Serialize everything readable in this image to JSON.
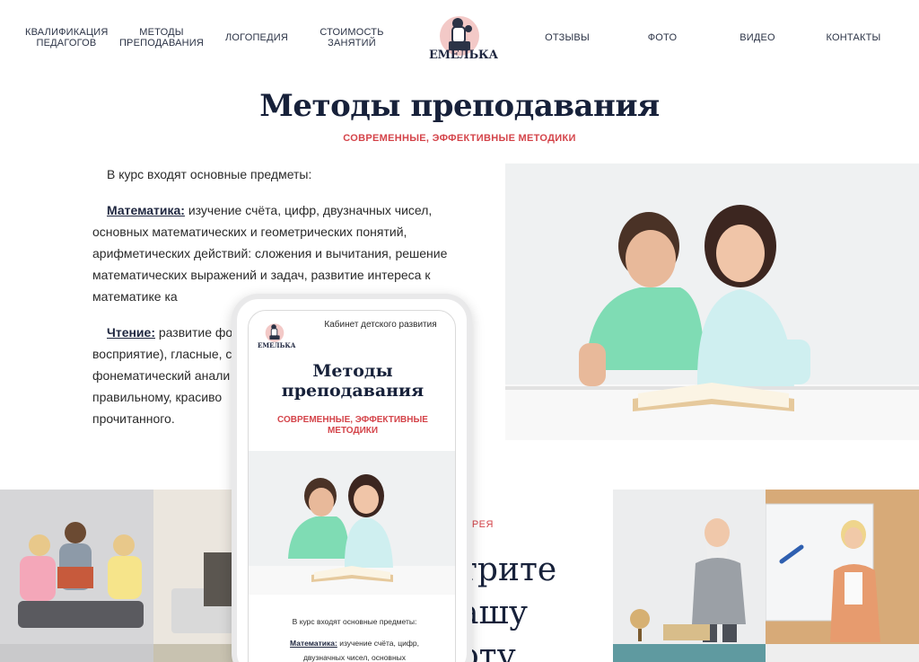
{
  "nav": {
    "items": [
      {
        "label": "КВАЛИФИКАЦИЯ\nПЕДАГОГОВ"
      },
      {
        "label": "МЕТОДЫ\nПРЕПОДАВАНИЯ"
      },
      {
        "label": "ЛОГОПЕДИЯ"
      },
      {
        "label": "СТОИМОСТЬ\nЗАНЯТИЙ"
      },
      {
        "label": "ОТЗЫВЫ"
      },
      {
        "label": "ФОТО"
      },
      {
        "label": "ВИДЕО"
      },
      {
        "label": "КОНТАКТЫ"
      }
    ],
    "logo_text": "ЕМЕЛЬКА"
  },
  "hero": {
    "title": "Методы преподавания",
    "subtitle": "СОВРЕМЕННЫЕ, ЭФФЕКТИВНЫЕ МЕТОДИКИ"
  },
  "content": {
    "intro": "В курс входят основные предметы:",
    "math_term": "Математика:",
    "math_text": " изучение счёта, цифр, двузначных чисел, основных математических и геометрических понятий, арифметических действий: сложения и вычитания, решение математических выражений и задач, развитие интереса к математике ка",
    "reading_term": "Чтение:",
    "reading_text": " развитие фо",
    "reading_line2": "восприятие), гласные, с",
    "reading_line3": "фонематический анали",
    "reading_line4": "правильному, красиво",
    "reading_line5": "прочитанного."
  },
  "gallery": {
    "label": "ЕРЕЯ",
    "heading_line1": "трите",
    "heading_line2": "ашу",
    "heading_line3": "оту"
  },
  "phone": {
    "logo_text": "ЕМЕЛЬКА",
    "header_text": "Кабинет детского развития",
    "title": "Методы\nпреподавания",
    "subtitle": "СОВРЕМЕННЫЕ, ЭФФЕКТИВНЫЕ\nМЕТОДИКИ",
    "intro": "В курс входят основные предметы:",
    "math_term": "Математика:",
    "math_text": " изучение счёта, цифр,",
    "math_line2": "двузначных чисел, основных"
  },
  "colors": {
    "accent": "#d4444a",
    "heading": "#17213a",
    "nav": "#2b3346"
  }
}
